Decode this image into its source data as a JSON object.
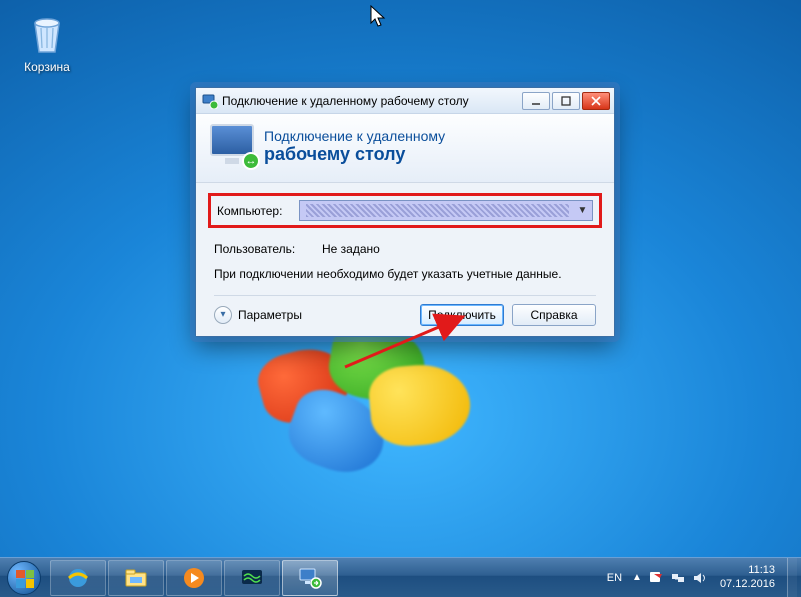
{
  "desktop": {
    "recycle_bin_label": "Корзина"
  },
  "dialog": {
    "title": "Подключение к удаленному рабочему столу",
    "header_line1": "Подключение к удаленному",
    "header_line2": "рабочему столу",
    "computer_label": "Компьютер:",
    "computer_value": "",
    "user_label": "Пользователь:",
    "user_value": "Не задано",
    "info_text": "При подключении необходимо будет указать учетные данные.",
    "options_label": "Параметры",
    "connect_label": "Подключить",
    "help_label": "Справка"
  },
  "taskbar": {
    "lang": "EN",
    "time": "11:13",
    "date": "07.12.2016"
  }
}
